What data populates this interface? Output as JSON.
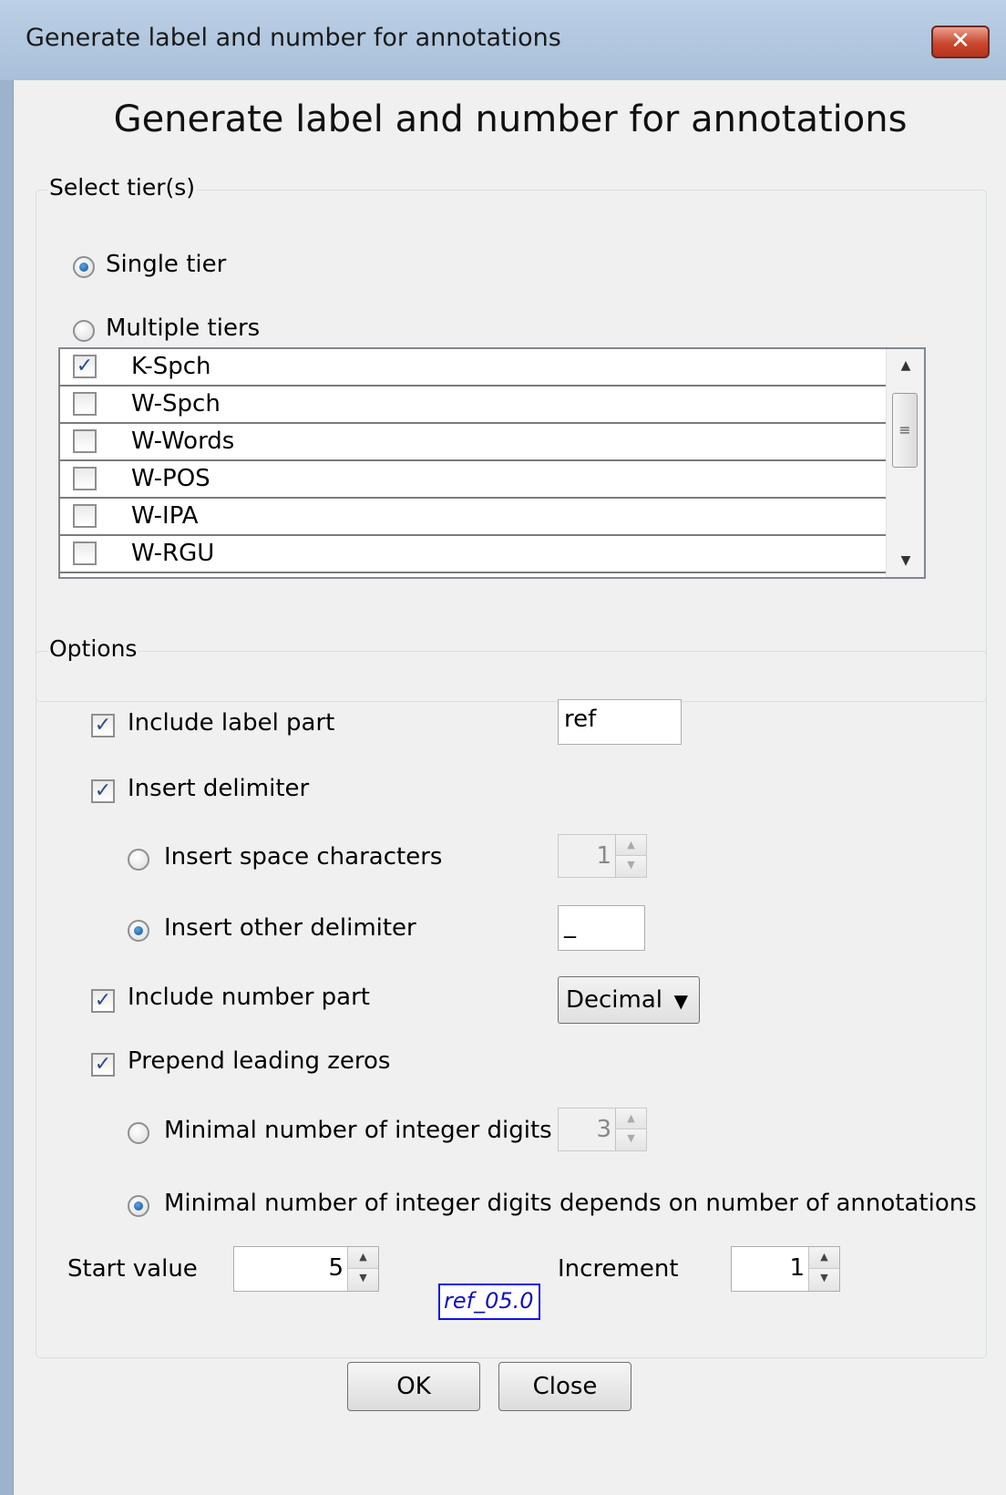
{
  "window": {
    "title": "Generate label and number for annotations",
    "close_label": "✕"
  },
  "dialog": {
    "heading": "Generate label and number for annotations"
  },
  "tier_group": {
    "legend": "Select tier(s)",
    "single_label": "Single tier",
    "single_selected": true,
    "multiple_label": "Multiple tiers",
    "multiple_selected": false,
    "tiers": [
      {
        "label": "K-Spch",
        "checked": true
      },
      {
        "label": "W-Spch",
        "checked": false
      },
      {
        "label": "W-Words",
        "checked": false
      },
      {
        "label": "W-POS",
        "checked": false
      },
      {
        "label": "W-IPA",
        "checked": false
      },
      {
        "label": "W-RGU",
        "checked": false
      }
    ]
  },
  "options": {
    "legend": "Options",
    "include_label": {
      "label": "Include label part",
      "checked": true,
      "value": "ref"
    },
    "insert_delimiter": {
      "label": "Insert delimiter",
      "checked": true
    },
    "space_chars": {
      "label": "Insert space characters",
      "selected": false,
      "value": "1"
    },
    "other_delim": {
      "label": "Insert other delimiter",
      "selected": true,
      "value": "_"
    },
    "include_number": {
      "label": "Include number part",
      "checked": true,
      "format": "Decimal"
    },
    "leading_zeros": {
      "label": "Prepend leading zeros",
      "checked": true
    },
    "min_digits": {
      "label": "Minimal number of integer digits",
      "selected": false,
      "value": "3"
    },
    "min_digits_auto": {
      "label": "Minimal number of integer digits depends on number of annotations",
      "selected": true
    },
    "start_value": {
      "label": "Start value",
      "value": "5"
    },
    "increment": {
      "label": "Increment",
      "value": "1"
    },
    "preview": "ref_05.0"
  },
  "buttons": {
    "ok": "OK",
    "close": "Close"
  }
}
